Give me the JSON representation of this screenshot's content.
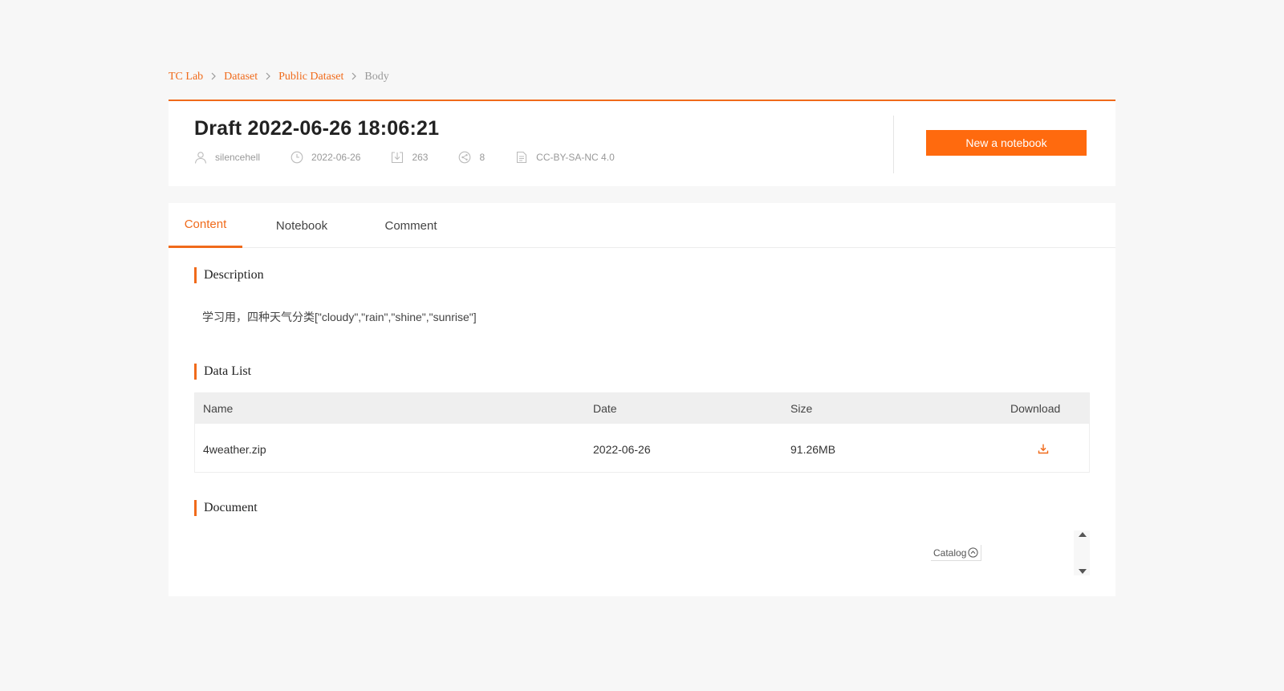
{
  "breadcrumb": {
    "items": [
      "TC Lab",
      "Dataset",
      "Public Dataset"
    ],
    "current": "Body"
  },
  "dataset": {
    "title": "Draft 2022-06-26 18:06:21",
    "author": "silencehell",
    "date": "2022-06-26",
    "downloads": "263",
    "shares": "8",
    "license": "CC-BY-SA-NC 4.0",
    "new_notebook_label": "New a notebook"
  },
  "tabs": [
    {
      "label": "Content",
      "active": true
    },
    {
      "label": "Notebook",
      "active": false
    },
    {
      "label": "Comment",
      "active": false
    }
  ],
  "sections": {
    "description_title": "Description",
    "description_text": "学习用，四种天气分类[\"cloudy\",\"rain\",\"shine\",\"sunrise\"]",
    "data_list_title": "Data List",
    "document_title": "Document"
  },
  "table": {
    "headers": [
      "Name",
      "Date",
      "Size",
      "Download"
    ],
    "rows": [
      {
        "name": "4weather.zip",
        "date": "2022-06-26",
        "size": "91.26MB"
      }
    ]
  },
  "catalog": {
    "label": "Catalog"
  },
  "colors": {
    "accent": "#f06a1a",
    "button": "#ff6a0e"
  }
}
